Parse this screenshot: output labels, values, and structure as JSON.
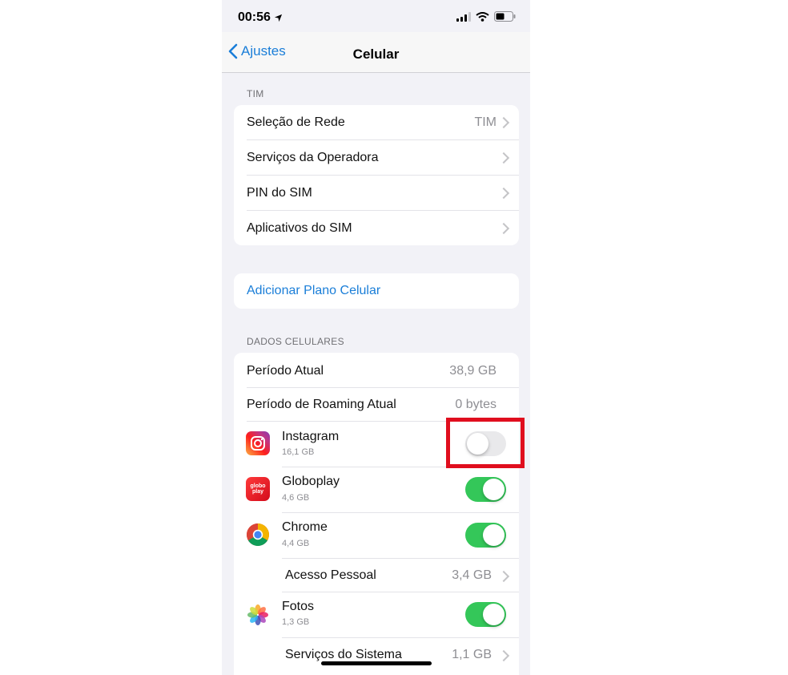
{
  "status_bar": {
    "time": "00:56",
    "icons": [
      "location-arrow-icon",
      "signal-icon",
      "wifi-icon",
      "battery-icon"
    ]
  },
  "nav": {
    "back_label": "Ajustes",
    "title": "Celular"
  },
  "carrier_section": {
    "header": "TIM",
    "rows": [
      {
        "label": "Seleção de Rede",
        "value": "TIM"
      },
      {
        "label": "Serviços da Operadora",
        "value": ""
      },
      {
        "label": "PIN do SIM",
        "value": ""
      },
      {
        "label": "Aplicativos do SIM",
        "value": ""
      }
    ]
  },
  "add_plan": {
    "label": "Adicionar Plano Celular"
  },
  "data_section": {
    "header": "DADOS CELULARES",
    "current_period": {
      "label": "Período Atual",
      "value": "38,9 GB"
    },
    "roaming_period": {
      "label": "Período de Roaming Atual",
      "value": "0 bytes"
    },
    "apps": [
      {
        "name": "Instagram",
        "size": "16,1 GB",
        "enabled": false,
        "icon": "instagram-icon"
      },
      {
        "name": "Globoplay",
        "size": "4,6 GB",
        "enabled": true,
        "icon": "globoplay-icon",
        "icon_text": "globo play"
      },
      {
        "name": "Chrome",
        "size": "4,4 GB",
        "enabled": true,
        "icon": "chrome-icon"
      }
    ],
    "personal_hotspot": {
      "label": "Acesso Pessoal",
      "value": "3,4 GB"
    },
    "photos": {
      "name": "Fotos",
      "size": "1,3 GB",
      "enabled": true,
      "icon": "photos-icon"
    },
    "system_services": {
      "label": "Serviços do Sistema",
      "value": "1,1 GB"
    }
  },
  "colors": {
    "accent": "#1a7ed8",
    "toggle_on": "#34c759",
    "highlight": "#e00e1e",
    "background": "#f2f2f7"
  }
}
